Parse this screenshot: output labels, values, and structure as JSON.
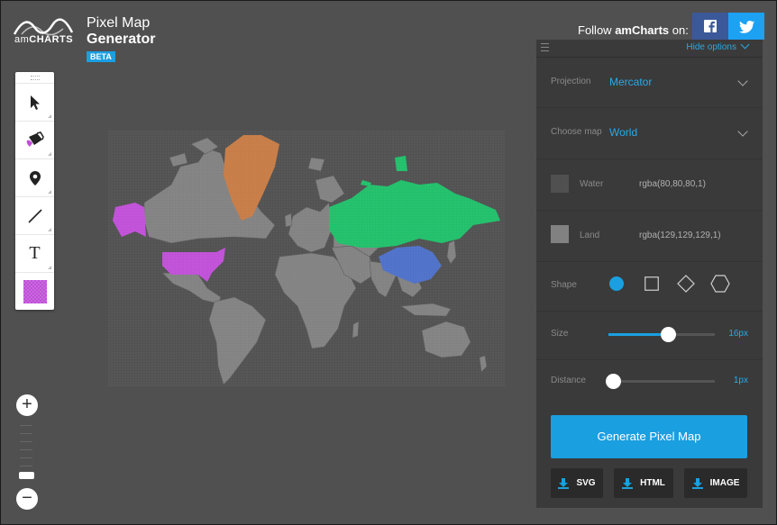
{
  "brand": {
    "logo_text_am": "am",
    "logo_text_charts": "CHARTS",
    "title_line1": "Pixel Map",
    "title_line2": "Generator",
    "badge": "BETA"
  },
  "social": {
    "follow_prefix": "Follow ",
    "follow_brand": "amCharts",
    "follow_suffix": " on:",
    "facebook_icon": "facebook-icon",
    "twitter_icon": "twitter-icon"
  },
  "toolbar": {
    "items": [
      "pointer-icon",
      "paint-icon",
      "pin-icon",
      "line-icon",
      "text-tool",
      "color-swatch"
    ],
    "text_tool_label": "T",
    "swatch_color": "#c04fd8"
  },
  "zoom": {
    "in_label": "+",
    "out_label": "−"
  },
  "map": {
    "colors": {
      "land": "#818181",
      "water": "#505050",
      "highlight_greenland": "#c77b45",
      "highlight_usa_alaska": "#c04fd8",
      "highlight_russia": "#1fbf6a",
      "highlight_china": "#4d6fc8"
    }
  },
  "panel": {
    "hide_options": "Hide options",
    "projection_label": "Projection",
    "projection_value": "Mercator",
    "map_label": "Choose map",
    "map_value": "World",
    "water_label": "Water",
    "water_value": "rgba(80,80,80,1)",
    "water_color": "#505050",
    "land_label": "Land",
    "land_value": "rgba(129,129,129,1)",
    "land_color": "#818181",
    "shape_label": "Shape",
    "shapes": [
      "circle",
      "square",
      "diamond",
      "hexagon"
    ],
    "selected_shape": "circle",
    "size_label": "Size",
    "size_value": "16px",
    "size_fraction": 0.56,
    "distance_label": "Distance",
    "distance_value": "1px",
    "distance_fraction": 0.05,
    "generate_label": "Generate Pixel Map",
    "download_svg": "SVG",
    "download_html": "HTML",
    "download_image": "IMAGE",
    "accent": "#1a9fe0"
  }
}
